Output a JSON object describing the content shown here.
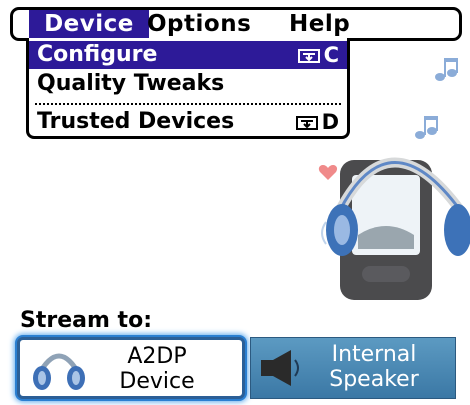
{
  "menubar": {
    "menus": [
      {
        "label": "Device",
        "active": true
      },
      {
        "label": "Options",
        "active": false
      },
      {
        "label": "Help",
        "active": false
      }
    ]
  },
  "dropdown": {
    "items": [
      {
        "label": "Configure",
        "shortcut": "C",
        "selected": true
      },
      {
        "label": "Quality Tweaks",
        "shortcut": "",
        "selected": false
      },
      {
        "label": "Trusted Devices",
        "shortcut": "D",
        "selected": false
      }
    ]
  },
  "stream": {
    "label": "Stream to:",
    "buttons": [
      {
        "line1": "A2DP",
        "line2": "Device",
        "icon": "headphones-icon"
      },
      {
        "line1": "Internal",
        "line2": "Speaker",
        "icon": "speaker-icon"
      }
    ]
  },
  "colors": {
    "highlight": "#2d1a98",
    "button_blue": "#4a88b5",
    "focus_ring": "#2b7fd1"
  }
}
